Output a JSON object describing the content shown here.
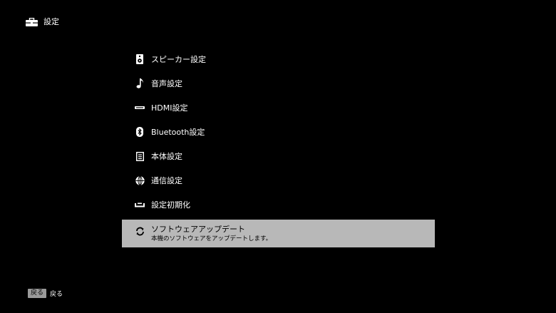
{
  "header": {
    "title": "設定",
    "icon": "toolbox-icon"
  },
  "menu": {
    "items": [
      {
        "label": "スピーカー設定",
        "icon": "speaker-icon"
      },
      {
        "label": "音声設定",
        "icon": "music-note-icon"
      },
      {
        "label": "HDMI設定",
        "icon": "hdmi-icon"
      },
      {
        "label": "Bluetooth設定",
        "icon": "bluetooth-icon"
      },
      {
        "label": "本体設定",
        "icon": "device-icon"
      },
      {
        "label": "通信設定",
        "icon": "globe-icon"
      },
      {
        "label": "設定初期化",
        "icon": "reset-icon"
      }
    ],
    "selected": {
      "label": "ソフトウェアアップデート",
      "description": "本機のソフトウェアをアップデートします。",
      "icon": "update-icon"
    }
  },
  "footer": {
    "back_key": "戻る",
    "back_label": "戻る"
  },
  "colors": {
    "background": "#000000",
    "selected_bg": "#b8b8b8",
    "key_bg": "#9a9a9a"
  }
}
